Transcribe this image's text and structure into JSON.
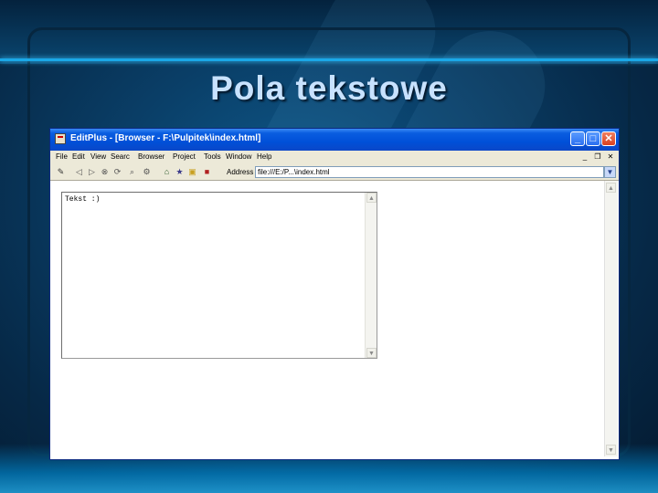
{
  "slide": {
    "title": "Pola tekstowe"
  },
  "window": {
    "title": "EditPlus - [Browser - F:\\Pulpitek\\index.html]",
    "controls": {
      "minimize": "_",
      "maximize": "□",
      "close": "✕"
    }
  },
  "menubar": {
    "items": [
      "File",
      "Edit",
      "View",
      "Searc",
      "Browser",
      "Project",
      "Tools",
      "Window",
      "Help"
    ]
  },
  "toolbar": {
    "address_label": "Address",
    "address_value": "file:///E:/P...\\index.html"
  },
  "textarea": {
    "value": "Tekst :)"
  },
  "colors": {
    "titlebar": "#0050d8",
    "menubar": "#ece9d8",
    "slide_title": "#c8e2ff"
  }
}
